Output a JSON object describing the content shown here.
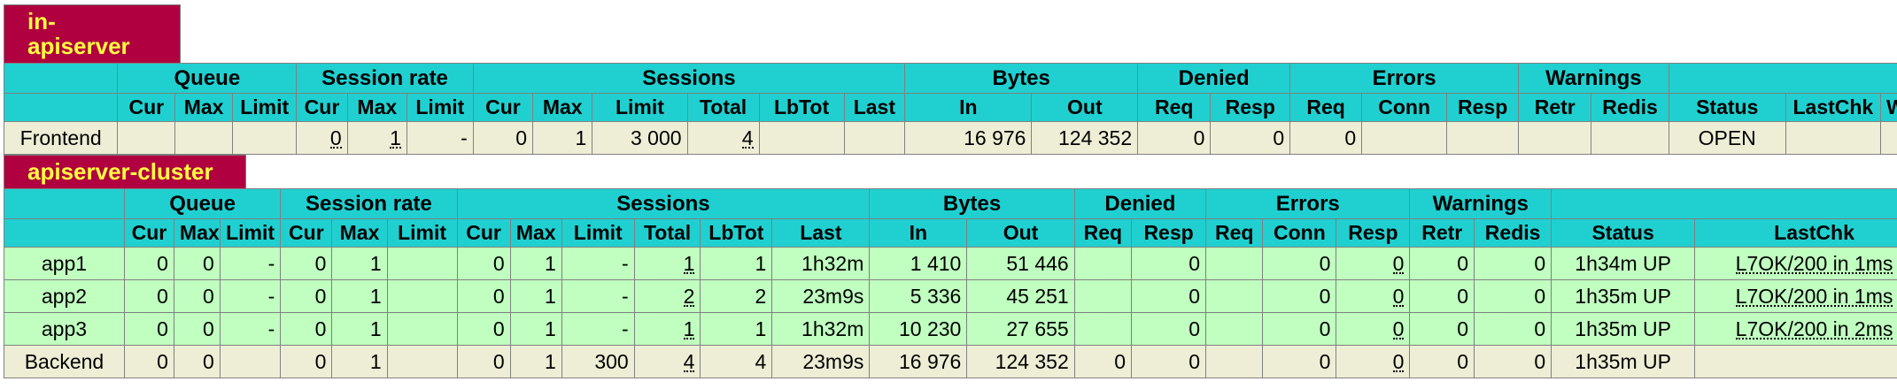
{
  "frontend": {
    "title": "in-apiserver",
    "groups": [
      "",
      "Queue",
      "Session rate",
      "Sessions",
      "Bytes",
      "Denied",
      "Errors",
      "Warnings",
      ""
    ],
    "subheaders": [
      "",
      "Cur",
      "Max",
      "Limit",
      "Cur",
      "Max",
      "Limit",
      "Cur",
      "Max",
      "Limit",
      "Total",
      "LbTot",
      "Last",
      "In",
      "Out",
      "Req",
      "Resp",
      "Req",
      "Conn",
      "Resp",
      "Retr",
      "Redis",
      "Status",
      "LastChk",
      "Wg"
    ],
    "row": [
      "Frontend",
      "",
      "",
      "",
      "0",
      "1",
      "-",
      "0",
      "1",
      "3 000",
      "4",
      "",
      "",
      "16 976",
      "124 352",
      "0",
      "0",
      "0",
      "",
      "",
      "",
      "",
      "OPEN",
      "",
      ""
    ]
  },
  "backend": {
    "title": "apiserver-cluster",
    "groups": [
      "",
      "Queue",
      "Session rate",
      "Sessions",
      "Bytes",
      "Denied",
      "Errors",
      "Warnings",
      ""
    ],
    "subheaders": [
      "",
      "Cur",
      "Max",
      "Limit",
      "Cur",
      "Max",
      "Limit",
      "Cur",
      "Max",
      "Limit",
      "Total",
      "LbTot",
      "Last",
      "In",
      "Out",
      "Req",
      "Resp",
      "Req",
      "Conn",
      "Resp",
      "Retr",
      "Redis",
      "Status",
      "LastChk"
    ],
    "rows": [
      [
        "app1",
        "0",
        "0",
        "-",
        "0",
        "1",
        "",
        "0",
        "1",
        "-",
        "1",
        "1",
        "1h32m",
        "1 410",
        "51 446",
        "",
        "0",
        "",
        "0",
        "0",
        "0",
        "0",
        "1h34m UP",
        "L7OK/200 in 1ms"
      ],
      [
        "app2",
        "0",
        "0",
        "-",
        "0",
        "1",
        "",
        "0",
        "1",
        "-",
        "2",
        "2",
        "23m9s",
        "5 336",
        "45 251",
        "",
        "0",
        "",
        "0",
        "0",
        "0",
        "0",
        "1h35m UP",
        "L7OK/200 in 1ms"
      ],
      [
        "app3",
        "0",
        "0",
        "-",
        "0",
        "1",
        "",
        "0",
        "1",
        "-",
        "1",
        "1",
        "1h32m",
        "10 230",
        "27 655",
        "",
        "0",
        "",
        "0",
        "0",
        "0",
        "0",
        "1h35m UP",
        "L7OK/200 in 2ms"
      ],
      [
        "Backend",
        "0",
        "0",
        "",
        "0",
        "1",
        "",
        "0",
        "1",
        "300",
        "4",
        "4",
        "23m9s",
        "16 976",
        "124 352",
        "0",
        "0",
        "",
        "0",
        "0",
        "0",
        "0",
        "1h35m UP",
        ""
      ]
    ]
  }
}
